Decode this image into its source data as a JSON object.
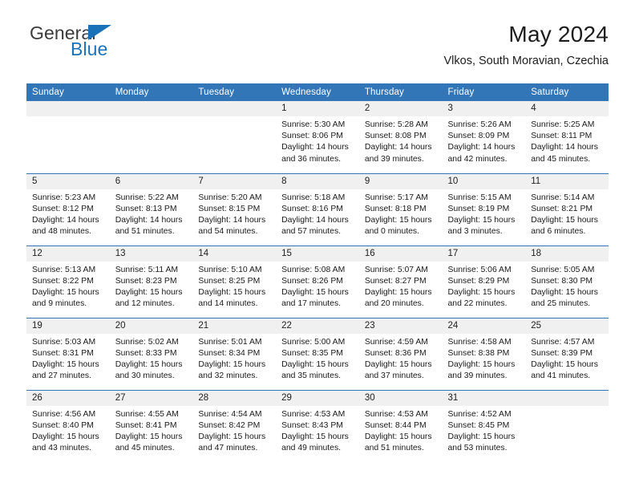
{
  "brand": {
    "name_part1": "General",
    "name_part2": "Blue",
    "accent_color": "#1b72b8",
    "logo_icon": "triangle-logo-icon"
  },
  "header": {
    "title": "May 2024",
    "location": "Vlkos, South Moravian, Czechia"
  },
  "theme": {
    "header_bg": "#3276b8",
    "daynum_bg": "#f0f0f0",
    "row_divider": "#3276b8"
  },
  "weekday_headers": [
    "Sunday",
    "Monday",
    "Tuesday",
    "Wednesday",
    "Thursday",
    "Friday",
    "Saturday"
  ],
  "weeks": [
    [
      {
        "day": "",
        "empty": true,
        "sunrise": "",
        "sunset": "",
        "daylight_line1": "",
        "daylight_line2": ""
      },
      {
        "day": "",
        "empty": true,
        "sunrise": "",
        "sunset": "",
        "daylight_line1": "",
        "daylight_line2": ""
      },
      {
        "day": "",
        "empty": true,
        "sunrise": "",
        "sunset": "",
        "daylight_line1": "",
        "daylight_line2": ""
      },
      {
        "day": "1",
        "empty": false,
        "sunrise": "Sunrise: 5:30 AM",
        "sunset": "Sunset: 8:06 PM",
        "daylight_line1": "Daylight: 14 hours",
        "daylight_line2": "and 36 minutes."
      },
      {
        "day": "2",
        "empty": false,
        "sunrise": "Sunrise: 5:28 AM",
        "sunset": "Sunset: 8:08 PM",
        "daylight_line1": "Daylight: 14 hours",
        "daylight_line2": "and 39 minutes."
      },
      {
        "day": "3",
        "empty": false,
        "sunrise": "Sunrise: 5:26 AM",
        "sunset": "Sunset: 8:09 PM",
        "daylight_line1": "Daylight: 14 hours",
        "daylight_line2": "and 42 minutes."
      },
      {
        "day": "4",
        "empty": false,
        "sunrise": "Sunrise: 5:25 AM",
        "sunset": "Sunset: 8:11 PM",
        "daylight_line1": "Daylight: 14 hours",
        "daylight_line2": "and 45 minutes."
      }
    ],
    [
      {
        "day": "5",
        "empty": false,
        "sunrise": "Sunrise: 5:23 AM",
        "sunset": "Sunset: 8:12 PM",
        "daylight_line1": "Daylight: 14 hours",
        "daylight_line2": "and 48 minutes."
      },
      {
        "day": "6",
        "empty": false,
        "sunrise": "Sunrise: 5:22 AM",
        "sunset": "Sunset: 8:13 PM",
        "daylight_line1": "Daylight: 14 hours",
        "daylight_line2": "and 51 minutes."
      },
      {
        "day": "7",
        "empty": false,
        "sunrise": "Sunrise: 5:20 AM",
        "sunset": "Sunset: 8:15 PM",
        "daylight_line1": "Daylight: 14 hours",
        "daylight_line2": "and 54 minutes."
      },
      {
        "day": "8",
        "empty": false,
        "sunrise": "Sunrise: 5:18 AM",
        "sunset": "Sunset: 8:16 PM",
        "daylight_line1": "Daylight: 14 hours",
        "daylight_line2": "and 57 minutes."
      },
      {
        "day": "9",
        "empty": false,
        "sunrise": "Sunrise: 5:17 AM",
        "sunset": "Sunset: 8:18 PM",
        "daylight_line1": "Daylight: 15 hours",
        "daylight_line2": "and 0 minutes."
      },
      {
        "day": "10",
        "empty": false,
        "sunrise": "Sunrise: 5:15 AM",
        "sunset": "Sunset: 8:19 PM",
        "daylight_line1": "Daylight: 15 hours",
        "daylight_line2": "and 3 minutes."
      },
      {
        "day": "11",
        "empty": false,
        "sunrise": "Sunrise: 5:14 AM",
        "sunset": "Sunset: 8:21 PM",
        "daylight_line1": "Daylight: 15 hours",
        "daylight_line2": "and 6 minutes."
      }
    ],
    [
      {
        "day": "12",
        "empty": false,
        "sunrise": "Sunrise: 5:13 AM",
        "sunset": "Sunset: 8:22 PM",
        "daylight_line1": "Daylight: 15 hours",
        "daylight_line2": "and 9 minutes."
      },
      {
        "day": "13",
        "empty": false,
        "sunrise": "Sunrise: 5:11 AM",
        "sunset": "Sunset: 8:23 PM",
        "daylight_line1": "Daylight: 15 hours",
        "daylight_line2": "and 12 minutes."
      },
      {
        "day": "14",
        "empty": false,
        "sunrise": "Sunrise: 5:10 AM",
        "sunset": "Sunset: 8:25 PM",
        "daylight_line1": "Daylight: 15 hours",
        "daylight_line2": "and 14 minutes."
      },
      {
        "day": "15",
        "empty": false,
        "sunrise": "Sunrise: 5:08 AM",
        "sunset": "Sunset: 8:26 PM",
        "daylight_line1": "Daylight: 15 hours",
        "daylight_line2": "and 17 minutes."
      },
      {
        "day": "16",
        "empty": false,
        "sunrise": "Sunrise: 5:07 AM",
        "sunset": "Sunset: 8:27 PM",
        "daylight_line1": "Daylight: 15 hours",
        "daylight_line2": "and 20 minutes."
      },
      {
        "day": "17",
        "empty": false,
        "sunrise": "Sunrise: 5:06 AM",
        "sunset": "Sunset: 8:29 PM",
        "daylight_line1": "Daylight: 15 hours",
        "daylight_line2": "and 22 minutes."
      },
      {
        "day": "18",
        "empty": false,
        "sunrise": "Sunrise: 5:05 AM",
        "sunset": "Sunset: 8:30 PM",
        "daylight_line1": "Daylight: 15 hours",
        "daylight_line2": "and 25 minutes."
      }
    ],
    [
      {
        "day": "19",
        "empty": false,
        "sunrise": "Sunrise: 5:03 AM",
        "sunset": "Sunset: 8:31 PM",
        "daylight_line1": "Daylight: 15 hours",
        "daylight_line2": "and 27 minutes."
      },
      {
        "day": "20",
        "empty": false,
        "sunrise": "Sunrise: 5:02 AM",
        "sunset": "Sunset: 8:33 PM",
        "daylight_line1": "Daylight: 15 hours",
        "daylight_line2": "and 30 minutes."
      },
      {
        "day": "21",
        "empty": false,
        "sunrise": "Sunrise: 5:01 AM",
        "sunset": "Sunset: 8:34 PM",
        "daylight_line1": "Daylight: 15 hours",
        "daylight_line2": "and 32 minutes."
      },
      {
        "day": "22",
        "empty": false,
        "sunrise": "Sunrise: 5:00 AM",
        "sunset": "Sunset: 8:35 PM",
        "daylight_line1": "Daylight: 15 hours",
        "daylight_line2": "and 35 minutes."
      },
      {
        "day": "23",
        "empty": false,
        "sunrise": "Sunrise: 4:59 AM",
        "sunset": "Sunset: 8:36 PM",
        "daylight_line1": "Daylight: 15 hours",
        "daylight_line2": "and 37 minutes."
      },
      {
        "day": "24",
        "empty": false,
        "sunrise": "Sunrise: 4:58 AM",
        "sunset": "Sunset: 8:38 PM",
        "daylight_line1": "Daylight: 15 hours",
        "daylight_line2": "and 39 minutes."
      },
      {
        "day": "25",
        "empty": false,
        "sunrise": "Sunrise: 4:57 AM",
        "sunset": "Sunset: 8:39 PM",
        "daylight_line1": "Daylight: 15 hours",
        "daylight_line2": "and 41 minutes."
      }
    ],
    [
      {
        "day": "26",
        "empty": false,
        "sunrise": "Sunrise: 4:56 AM",
        "sunset": "Sunset: 8:40 PM",
        "daylight_line1": "Daylight: 15 hours",
        "daylight_line2": "and 43 minutes."
      },
      {
        "day": "27",
        "empty": false,
        "sunrise": "Sunrise: 4:55 AM",
        "sunset": "Sunset: 8:41 PM",
        "daylight_line1": "Daylight: 15 hours",
        "daylight_line2": "and 45 minutes."
      },
      {
        "day": "28",
        "empty": false,
        "sunrise": "Sunrise: 4:54 AM",
        "sunset": "Sunset: 8:42 PM",
        "daylight_line1": "Daylight: 15 hours",
        "daylight_line2": "and 47 minutes."
      },
      {
        "day": "29",
        "empty": false,
        "sunrise": "Sunrise: 4:53 AM",
        "sunset": "Sunset: 8:43 PM",
        "daylight_line1": "Daylight: 15 hours",
        "daylight_line2": "and 49 minutes."
      },
      {
        "day": "30",
        "empty": false,
        "sunrise": "Sunrise: 4:53 AM",
        "sunset": "Sunset: 8:44 PM",
        "daylight_line1": "Daylight: 15 hours",
        "daylight_line2": "and 51 minutes."
      },
      {
        "day": "31",
        "empty": false,
        "sunrise": "Sunrise: 4:52 AM",
        "sunset": "Sunset: 8:45 PM",
        "daylight_line1": "Daylight: 15 hours",
        "daylight_line2": "and 53 minutes."
      },
      {
        "day": "",
        "empty": true,
        "sunrise": "",
        "sunset": "",
        "daylight_line1": "",
        "daylight_line2": ""
      }
    ]
  ]
}
